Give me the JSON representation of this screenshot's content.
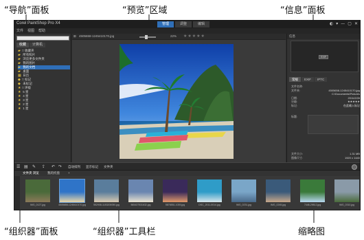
{
  "callouts": {
    "navigation": "“导航”面板",
    "preview": "“预览”区域",
    "info": "“信息”面板",
    "organizer": "“组织器”面板",
    "organizer_toolbar": "“组织器”工具栏",
    "thumbnails": "缩略图"
  },
  "app": {
    "title": "Corel PaintShop Pro X4",
    "mode_tabs": [
      "管理",
      "调整",
      "编辑"
    ],
    "window_controls": [
      "◐",
      "▾",
      "—",
      "▢",
      "✕"
    ],
    "menu": [
      "文件",
      "视图",
      "帮助"
    ]
  },
  "navigation": {
    "tabs": [
      "收藏",
      "计算机"
    ],
    "tree": [
      {
        "label": "□ 收藏夹",
        "icon": "folder-icon"
      },
      {
        "label": "  所有照片",
        "icon": "folder-icon"
      },
      {
        "label": "  浏览更多文件夹",
        "icon": "folder-icon"
      },
      {
        "label": "  我的图片",
        "icon": "folder-icon"
      },
      {
        "label": "  我的文档",
        "icon": "folder-icon",
        "selected": true
      },
      {
        "label": "  桌面",
        "icon": "folder-icon"
      },
      {
        "label": "  日历",
        "icon": "calendar-icon"
      },
      {
        "label": "□ 标记",
        "icon": "tag-icon"
      },
      {
        "label": "  未标记",
        "icon": "tag-icon"
      },
      {
        "label": "□ 评级",
        "icon": "star-icon"
      },
      {
        "label": "  5 星",
        "icon": "star-icon"
      },
      {
        "label": "  4 星",
        "icon": "star-icon"
      },
      {
        "label": "  3 星",
        "icon": "star-icon"
      },
      {
        "label": "  2 星",
        "icon": "star-icon"
      },
      {
        "label": "  1 星",
        "icon": "star-icon"
      }
    ]
  },
  "preview": {
    "filename": "4505658-1245410170.jpg",
    "zoom": "22%",
    "rating_stars": "★★★★★"
  },
  "info": {
    "header": "信息",
    "histogram_button": "EXIF",
    "tabs": [
      "常规",
      "EXIF",
      "IPTC"
    ],
    "rows": [
      {
        "label": "文件名称:",
        "value": ""
      },
      {
        "label": "文件夹:",
        "value": "4505658-1245410170.jpg"
      },
      {
        "label": "",
        "value": "C:\\Documents\\Pictures"
      },
      {
        "label": "日期:",
        "value": "2011/2/28"
      },
      {
        "label": "分级:",
        "value": "★★★★★"
      },
      {
        "label": "标记:",
        "value": "在此输入标记"
      }
    ],
    "footer_rows": [
      {
        "label": "文件大小:",
        "value": "1.31 MB"
      },
      {
        "label": "图像尺寸:",
        "value": "1920 x 1440"
      }
    ],
    "tag_label": "标题:"
  },
  "organizer_toolbar": {
    "labels": [
      "自动排列",
      "显示标记",
      "文件夹"
    ]
  },
  "thumb_tabs": [
    "文件夹 浏览",
    "我的托盘",
    "+"
  ],
  "thumbnails": [
    {
      "caption": "IMG_0127.jpg"
    },
    {
      "caption": "4505658-1245410170.jpg"
    },
    {
      "caption": "552908-1183200050.jpg"
    },
    {
      "caption": "565437531632.jpg"
    },
    {
      "caption": "5876551-1039.jpg"
    },
    {
      "caption": "DSC_2011-0014.jpg"
    },
    {
      "caption": "IMG_0231.jpg"
    },
    {
      "caption": "IMG_0245.jpg"
    },
    {
      "caption": "7448-29812.jpg"
    },
    {
      "caption": "IMG_0310.jpg"
    }
  ]
}
